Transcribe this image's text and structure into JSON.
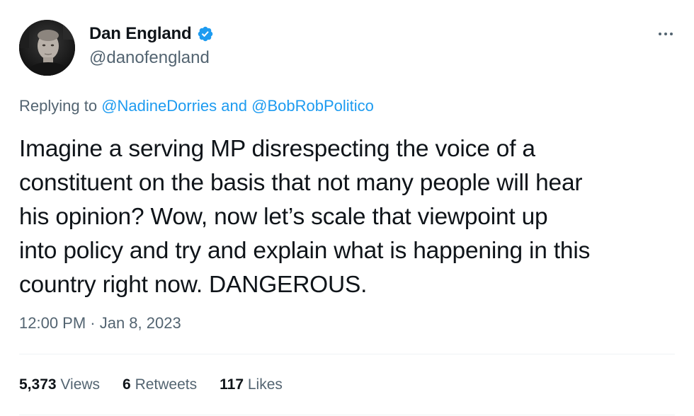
{
  "author": {
    "name": "Dan England",
    "handle": "@danofengland",
    "verified": true,
    "avatar_icon": "profile-photo"
  },
  "menu": {
    "icon": "more-horizontal-icon"
  },
  "reply_context": {
    "prefix": "Replying to",
    "mention1": "@NadineDorries",
    "connector": "and",
    "mention2": "@BobRobPolitico"
  },
  "tweet": {
    "lines": [
      "Imagine a serving MP disrespecting the voice of a",
      "constituent on the basis that not many people will hear",
      "his opinion? Wow, now let’s scale that viewpoint up",
      "into policy and try and explain what is happening in this",
      "country right now. DANGEROUS."
    ]
  },
  "timestamp": "12:00 PM · Jan 8, 2023",
  "stats": {
    "views_count": "5,373",
    "views_label": "Views",
    "retweets_count": "6",
    "retweets_label": "Retweets",
    "likes_count": "117",
    "likes_label": "Likes"
  },
  "colors": {
    "link": "#1d9bf0",
    "secondary_text": "#536471",
    "primary_text": "#0f1419",
    "divider": "#eff3f4"
  }
}
